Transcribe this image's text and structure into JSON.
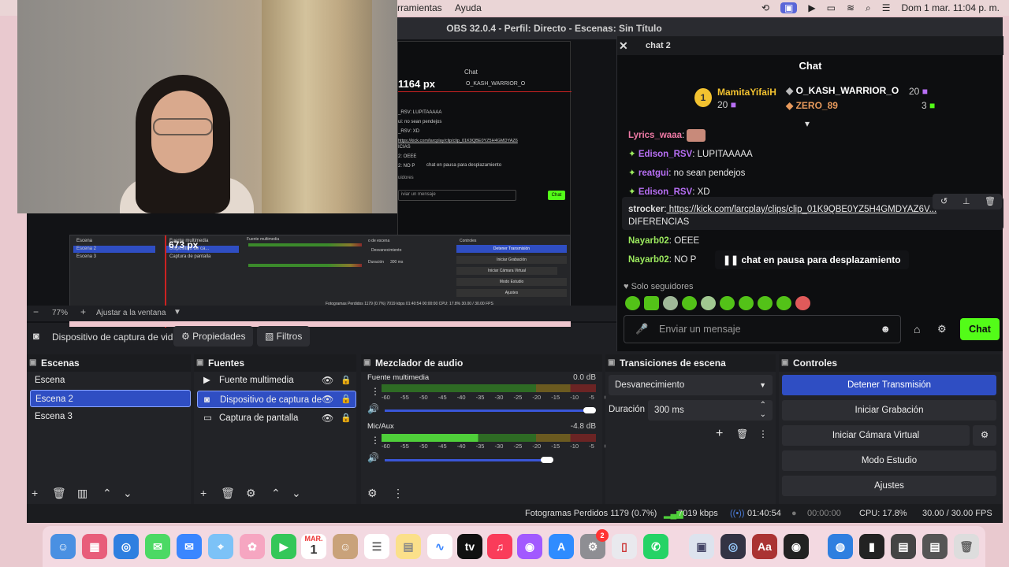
{
  "menubar": {
    "item1": "rramientas",
    "item2": "Ayuda",
    "datetime": "Dom 1 mar. 11:04 p. m."
  },
  "obs": {
    "title": "OBS 32.0.4 - Perfil: Directo - Escenas: Sin Título"
  },
  "preview": {
    "overlay_px1": "1164 px",
    "overlay_px2": "673 px",
    "mini_chat_title": "Chat",
    "mini_user": "O_KASH_WARRIOR_O",
    "mini_lines": [
      "_RSV: LUPITAAAAA",
      "ui: no sean pendejos",
      "_RSV: XD",
      "https://kick.com/larcplay/clip/clip_01K9QBE0YZ5H4GMDYAZ6",
      "ICIAS",
      "2: OEEE",
      "2: NO P"
    ],
    "mini_pause": "chat en pausa para desplazamiento",
    "mini_followers": "uidores",
    "mini_msg": "iviar un mensaje",
    "mini_chat_btn": "Chat",
    "mini_scenes": [
      "Escena",
      "Escena 2",
      "Escena 3"
    ],
    "mini_sources": [
      "Fuente multimedia",
      "Dispositivo de ca...",
      "Captura de pantalla"
    ],
    "mini_mixer": "Fuente multimedia",
    "mini_transition": "Desvanecimiento",
    "mini_duration_label": "Duración",
    "mini_duration": "300 ms",
    "mini_transitions_title": "o de escena",
    "mini_controls_title": "Controles",
    "mini_controls": [
      "Detener Transmisión",
      "Iniciar Grabación",
      "Iniciar Cámara Virtual",
      "Modo Estudio",
      "Ajustes"
    ],
    "mini_status": "Fotogramas Perdidos 1179 (0.7%)   7019 kbps   01:40:54   00:00:00   CPU: 17.8%   30.00 / 30.00 FPS"
  },
  "zoom": {
    "minus": "−",
    "value": "77%",
    "plus": "+",
    "fit": "Ajustar a la ventana"
  },
  "source_toolbar": {
    "source": "Dispositivo de captura de vid",
    "properties": "Propiedades",
    "filters": "Filtros"
  },
  "chat": {
    "dock_title": "chat 2",
    "title": "Chat",
    "top_gifters": [
      {
        "rank": "1",
        "name": "MamitaYifaiH",
        "count": "20"
      },
      {
        "name": "O_KASH_WARRIOR_O",
        "count": "20"
      },
      {
        "name": "ZERO_89",
        "count": "3"
      }
    ],
    "messages": [
      {
        "user": "Lyrics_waaa",
        "sep": ":",
        "text": ""
      },
      {
        "user": "Edison_RSV",
        "sep": ":",
        "text": " LUPITAAAAA"
      },
      {
        "user": "reatgui",
        "sep": ":",
        "text": " no sean pendejos"
      },
      {
        "user": "Edison_RSV",
        "sep": ":",
        "text": " XD"
      },
      {
        "user": "strocker",
        "sep": ":",
        "text": " https://kick.com/larcplay/clips/clip_01K9QBE0YZ5H4GMDYAZ6V..."
      },
      {
        "user": "",
        "sep": "",
        "text": "DIFERENCIAS"
      },
      {
        "user": "Nayarb02",
        "sep": ":",
        "text": " OEEE"
      },
      {
        "user": "Nayarb02",
        "sep": ":",
        "text": " NO P"
      }
    ],
    "pause": "chat en pausa para desplazamiento",
    "followers_only": "Solo seguidores",
    "placeholder": "Enviar un mensaje",
    "send": "Chat"
  },
  "scenes": {
    "title": "Escenas",
    "items": [
      "Escena",
      "Escena 2",
      "Escena 3"
    ]
  },
  "sources": {
    "title": "Fuentes",
    "items": [
      "Fuente multimedia",
      "Dispositivo de captura de",
      "Captura de pantalla"
    ]
  },
  "mixer": {
    "title": "Mezclador de audio",
    "channels": [
      {
        "name": "Fuente multimedia",
        "db": "0.0 dB",
        "level": 0.0,
        "volume": 1.0
      },
      {
        "name": "Mic/Aux",
        "db": "-4.8 dB",
        "level": 0.0,
        "volume": 0.78
      }
    ],
    "ticks": "-60 -55 -50 -45 -40 -35 -30 -25 -20 -15 -10 -5 0"
  },
  "transitions": {
    "title": "Transiciones de escena",
    "selected": "Desvanecimiento",
    "duration_label": "Duración",
    "duration": "300 ms"
  },
  "controls": {
    "title": "Controles",
    "stop_stream": "Detener Transmisión",
    "start_rec": "Iniciar Grabación",
    "virtual_cam": "Iniciar Cámara Virtual",
    "studio": "Modo Estudio",
    "settings": "Ajustes"
  },
  "status": {
    "dropped": "Fotogramas Perdidos 1179 (0.7%)",
    "bitrate": "7019 kbps",
    "stream_time": "01:40:54",
    "rec_time": "00:00:00",
    "cpu": "CPU: 17.8%",
    "fps": "30.00 / 30.00 FPS"
  },
  "dock": {
    "calendar_month": "MAR.",
    "calendar_day": "1",
    "badge": "2"
  },
  "colors": {
    "accent": "#2f4ec3",
    "kick_green": "#53fc18",
    "obs_bg": "#1e1f23"
  }
}
